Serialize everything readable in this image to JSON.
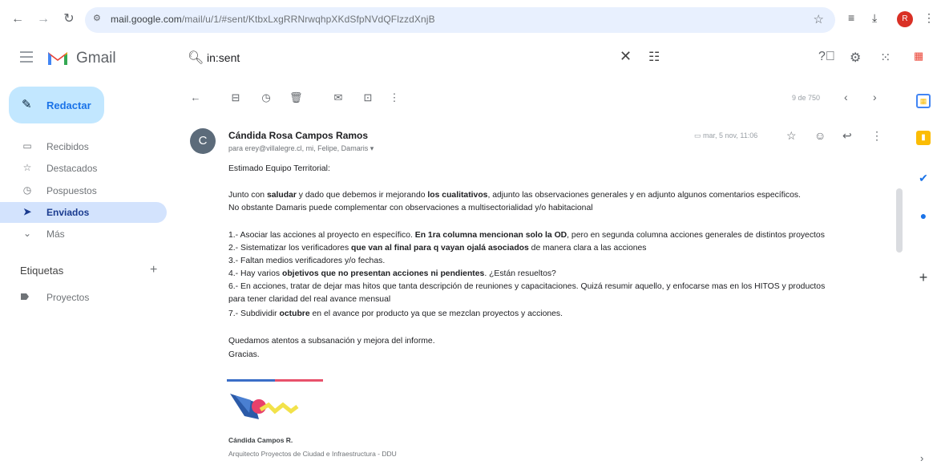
{
  "browser": {
    "url_host": "mail.google.com",
    "url_path": "/mail/u/1/#sent/KtbxLxgRRNrwqhpXKdSfpNVdQFlzzdXnjB"
  },
  "gmail": {
    "logo_text": "Gmail",
    "search": {
      "query": "in:sent"
    }
  },
  "compose": {
    "label": "Redactar"
  },
  "sidebar": {
    "items": [
      {
        "label": "Recibidos",
        "icon": "inbox-icon",
        "glyph": "▭"
      },
      {
        "label": "Destacados",
        "icon": "star-icon",
        "glyph": "☆"
      },
      {
        "label": "Pospuestos",
        "icon": "clock-icon",
        "glyph": "◷"
      },
      {
        "label": "Enviados",
        "icon": "send-icon",
        "glyph": "➤",
        "active": true
      },
      {
        "label": "Más",
        "icon": "chevron-down-icon",
        "glyph": "⌄"
      }
    ],
    "labels_title": "Etiquetas",
    "labels": [
      {
        "label": "Proyectos"
      }
    ]
  },
  "toolbar": {
    "pager": "9 de 750"
  },
  "email": {
    "avatar_letter": "C",
    "sender": "Cándida Rosa Campos Ramos",
    "recipients": "para erey@villalegre.cl, mi, Felipe, Damaris",
    "date": "mar, 5 nov, 11:06",
    "greeting": "Estimado Equipo Territorial:",
    "para1_a": "Junto con ",
    "para1_b": "saludar",
    "para1_c": " y dado que debemos ir mejorando ",
    "para1_d": "los cualitativos",
    "para1_e": ", adjunto las observaciones generales y en adjunto algunos comentarios específicos.",
    "para1_line2": "No obstante Damaris puede complementar con observaciones a multisectorialidad y/o habitacional",
    "item1_a": "1.- Asociar las acciones al proyecto en específico. ",
    "item1_b": "En 1ra columna mencionan solo la OD",
    "item1_c": ", pero en segunda columna acciones generales de distintos proyectos",
    "item2_a": "2.- Sistematizar los verificadores ",
    "item2_b": "que van al final para q vayan ojalá asociados",
    "item2_c": " de manera clara a las acciones",
    "item3": "3.- Faltan medios verificadores y/o fechas.",
    "item4_a": "4.- Hay varios ",
    "item4_b": "objetivos que no presentan acciones ni pendientes",
    "item4_c": ". ¿Están resueltos?",
    "item6": "6.- En acciones, tratar de dejar mas hitos que tanta descripción de reuniones y capacitaciones. Quizá resumir aquello, y enfocarse mas en los HITOS y productos",
    "item6_line2": "para tener claridad del real avance mensual",
    "item7_a": "7.- Subdividir ",
    "item7_b": "octubre",
    "item7_c": " en el avance por producto ya que se mezclan proyectos y acciones.",
    "closing1": "Quedamos atentos a subsanación y mejora del informe.",
    "closing2": "Gracias.",
    "sig_name": "Cándida Campos R.",
    "sig_title": "Arquitecto Proyectos de Ciudad e Infraestructura - DDU"
  },
  "colors": {
    "compose_bg": "#c2e7ff",
    "active_nav_bg": "#d3e3fd",
    "omnibox_bg": "#e8f0fe",
    "gmail_red": "#ea4335"
  }
}
